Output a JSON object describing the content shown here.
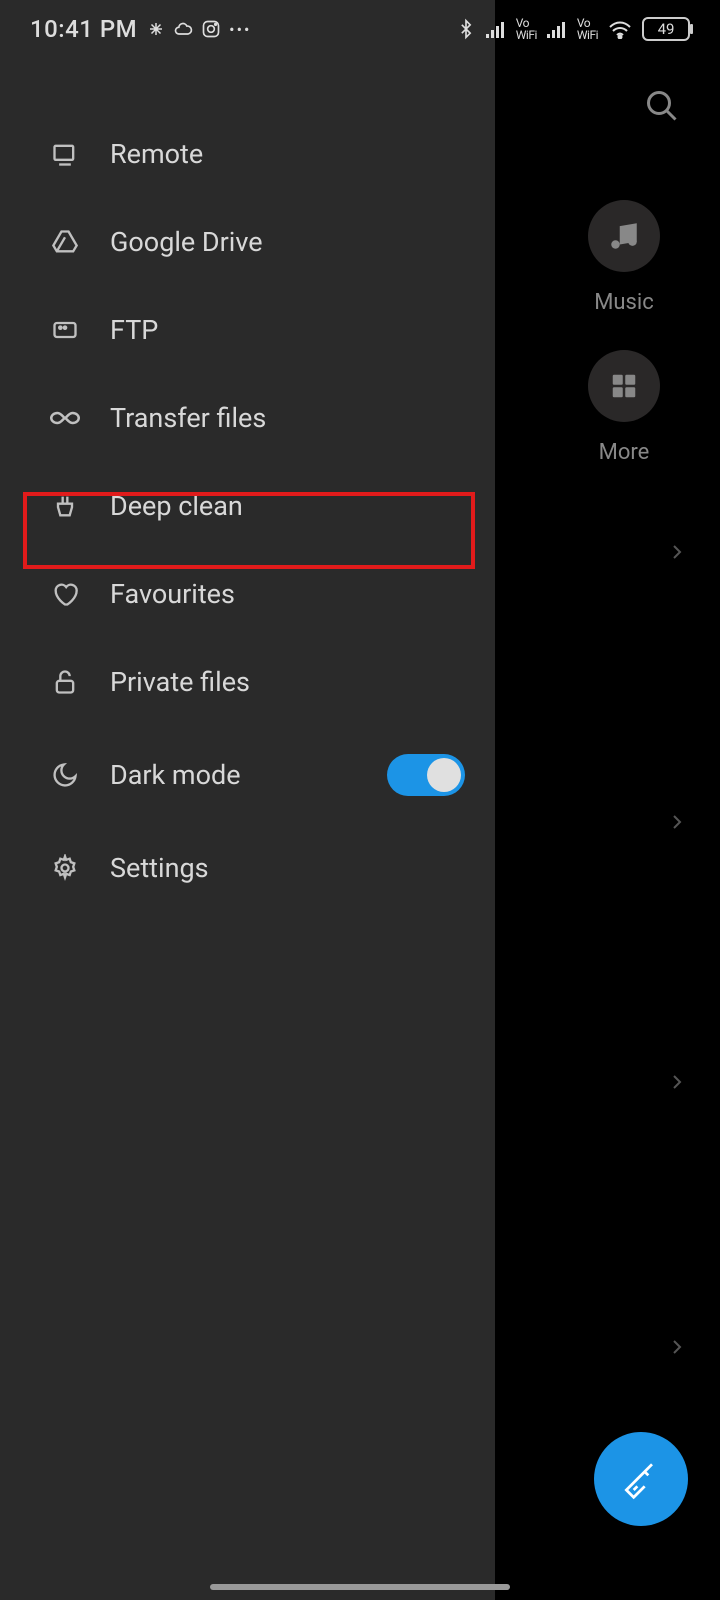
{
  "status": {
    "time": "10:41 PM",
    "battery": "49"
  },
  "drawer": {
    "items": {
      "remote": "Remote",
      "gdrive": "Google Drive",
      "ftp": "FTP",
      "transfer": "Transfer files",
      "deepclean": "Deep clean",
      "favourites": "Favourites",
      "private": "Private files",
      "darkmode": "Dark mode",
      "settings": "Settings"
    },
    "darkmode_on": true
  },
  "main": {
    "categories": {
      "music": "Music",
      "more": "More"
    }
  },
  "colors": {
    "accent": "#1c94e6",
    "highlight": "#e11b1b",
    "drawer_bg": "#2a2a2a"
  }
}
